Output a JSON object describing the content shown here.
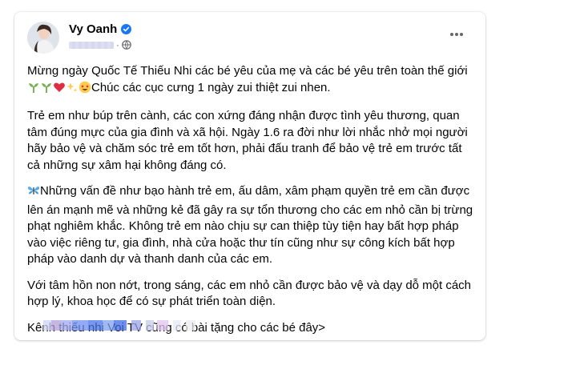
{
  "post": {
    "author_name": "Vy Oanh",
    "verified": true,
    "timestamp_obscured": true,
    "privacy_icon": "globe-icon",
    "more_icon": "more-horizontal-icon",
    "paragraphs": [
      {
        "text": "Mừng ngày Quốc Tế Thiếu Nhi các bé yêu của mẹ và các bé yêu trên toàn thế giới",
        "emoji_line_text": "Chúc các cục cưng 1 ngày zui thiệt zui nhen."
      },
      {
        "text": "Trẻ em như búp trên cành, các con xứng đáng nhận được tình yêu thương, quan tâm đúng mực của gia đình và xã hội. Ngày 1.6 ra đời như lời nhắc nhở mọi người hãy bảo vệ và chăm sóc trẻ em tốt hơn, phải đấu tranh để bảo vệ trẻ em trước tất cả những sự xâm hại không đáng có."
      },
      {
        "text": "Những vấn đề như bạo hành trẻ em, ấu dâm, xâm phạm quyền trẻ em cần được lên án mạnh mẽ và những kẻ đã gây ra sự tổn thương cho các em nhỏ cần bị trừng phạt nghiêm khắc. Không trẻ em nào chịu sự can thiệp tùy tiện hay bất hợp pháp vào việc riêng tư, gia đình, nhà cửa hoặc thư tín cũng như sự công kích bất hợp pháp vào danh dự và thanh danh của các em."
      },
      {
        "text": "Với tâm hồn non nớt, trong sáng, các em nhỏ cần được bảo vệ và dạy dỗ một cách hợp lý, khoa học để có sự phát triển toàn diện."
      },
      {
        "text": "Kênh thiếu nhi Voi TV cũng có bài tặng cho các bé đây>"
      }
    ],
    "link_obscured": true
  },
  "colors": {
    "verified_blue": "#1877f2",
    "secondary_text": "#65676b",
    "heart_red": "#e0245e"
  }
}
